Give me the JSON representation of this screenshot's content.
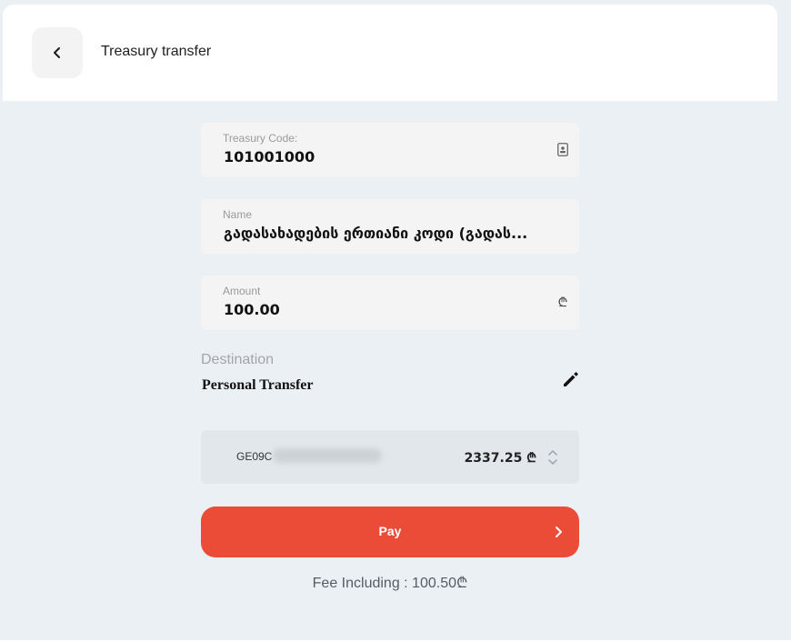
{
  "header": {
    "title": "Treasury transfer",
    "back_icon": "chevron-left-icon"
  },
  "fields": {
    "treasury_code": {
      "label": "Treasury Code:",
      "value": "101001000",
      "icon": "contact-book-icon"
    },
    "name": {
      "label": "Name",
      "value": "გადასახადების ერთიანი კოდი (გადას..."
    },
    "amount": {
      "label": "Amount",
      "value": "100.00",
      "icon": "lari-currency-icon"
    }
  },
  "destination": {
    "label": "Destination",
    "value": "Personal Transfer",
    "icon": "pencil-edit-icon"
  },
  "account": {
    "iban_prefix": "GE09C",
    "balance": "2337.25 ₾",
    "icon": "up-down-chevron-icon"
  },
  "pay": {
    "label": "Pay",
    "icon": "chevron-right-icon",
    "color": "#ea4c38"
  },
  "fee": {
    "text": "Fee Including : 100.50₾"
  }
}
